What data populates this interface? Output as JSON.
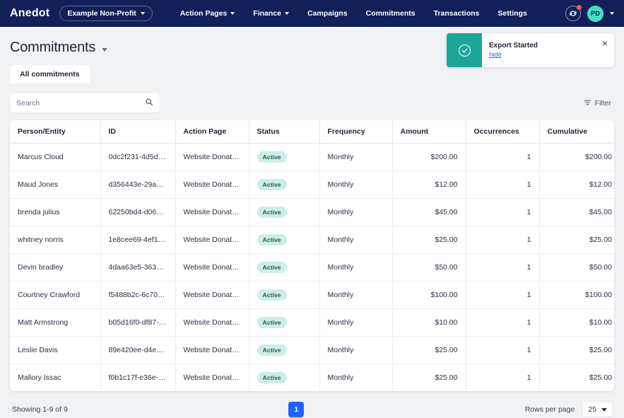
{
  "navbar": {
    "brand": "Anedot",
    "org_selector": {
      "label": "Example Non-Profit"
    },
    "links": [
      {
        "label": "Action Pages",
        "has_caret": true
      },
      {
        "label": "Finance",
        "has_caret": true
      },
      {
        "label": "Campaigns",
        "has_caret": false
      },
      {
        "label": "Commitments",
        "has_caret": false
      },
      {
        "label": "Transactions",
        "has_caret": false
      },
      {
        "label": "Settings",
        "has_caret": false
      }
    ],
    "sync_icon": "sync-icon",
    "notification_dot_color": "#ff5c39",
    "avatar": {
      "initials": "PD",
      "color": "#48dfc1"
    }
  },
  "header": {
    "title": "Commitments",
    "tabs": [
      {
        "label": "All commitments",
        "active": true
      }
    ]
  },
  "toast": {
    "icon": "check-circle-icon",
    "icon_bg": "#1aa699",
    "title": "Export Started",
    "link": "hide",
    "close": "×"
  },
  "toolbar": {
    "search": {
      "placeholder": "Search",
      "value": "",
      "icon": "search-icon"
    },
    "filter": {
      "label": "Filter",
      "icon": "filter-icon"
    }
  },
  "table": {
    "columns": [
      "Person/Entity",
      "ID",
      "Action Page",
      "Status",
      "Frequency",
      "Amount",
      "Occurrences",
      "Cumulative"
    ],
    "rows": [
      {
        "person": "Marcus Cloud",
        "id": "0dc2f231-4d5d-…",
        "page": "Website Donation …",
        "status": "Active",
        "frequency": "Monthly",
        "amount": "$200.00",
        "occurrences": "1",
        "cumulative": "$200.00"
      },
      {
        "person": "Maud Jones",
        "id": "d356443e-29a3-…",
        "page": "Website Donation …",
        "status": "Active",
        "frequency": "Monthly",
        "amount": "$12.00",
        "occurrences": "1",
        "cumulative": "$12.00"
      },
      {
        "person": "brenda julius",
        "id": "62250bd4-d060-…",
        "page": "Website Donation …",
        "status": "Active",
        "frequency": "Monthly",
        "amount": "$45.00",
        "occurrences": "1",
        "cumulative": "$45.00"
      },
      {
        "person": "whitney norris",
        "id": "1e8cee69-4ef1-4…",
        "page": "Website Donation …",
        "status": "Active",
        "frequency": "Monthly",
        "amount": "$25.00",
        "occurrences": "1",
        "cumulative": "$25.00"
      },
      {
        "person": "Devin bradley",
        "id": "4daa63e5-363e-…",
        "page": "Website Donation …",
        "status": "Active",
        "frequency": "Monthly",
        "amount": "$50.00",
        "occurrences": "1",
        "cumulative": "$50.00"
      },
      {
        "person": "Courtney Crawford",
        "id": "f5488b2c-6c70-4…",
        "page": "Website Donation …",
        "status": "Active",
        "frequency": "Monthly",
        "amount": "$100.00",
        "occurrences": "1",
        "cumulative": "$100.00"
      },
      {
        "person": "Matt Armstrong",
        "id": "b05d16f0-df87-4…",
        "page": "Website Donation …",
        "status": "Active",
        "frequency": "Monthly",
        "amount": "$10.00",
        "occurrences": "1",
        "cumulative": "$10.00"
      },
      {
        "person": "Leslie Davis",
        "id": "89e420ee-d4e6-…",
        "page": "Website Donation …",
        "status": "Active",
        "frequency": "Monthly",
        "amount": "$25.00",
        "occurrences": "1",
        "cumulative": "$25.00"
      },
      {
        "person": "Mallory Issac",
        "id": "f0b1c17f-e36e-4…",
        "page": "Website Donation …",
        "status": "Active",
        "frequency": "Monthly",
        "amount": "$25.00",
        "occurrences": "1",
        "cumulative": "$25.00"
      }
    ]
  },
  "footer": {
    "showing": "Showing 1-9 of 9",
    "current_page": "1",
    "rows_per_page_label": "Rows per page",
    "rows_per_page_value": "25"
  }
}
